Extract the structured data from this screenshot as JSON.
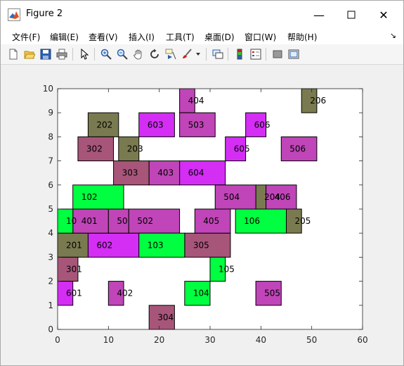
{
  "window": {
    "title": "Figure 2"
  },
  "menus": [
    "文件(F)",
    "编辑(E)",
    "查看(V)",
    "插入(I)",
    "工具(T)",
    "桌面(D)",
    "窗口(W)",
    "帮助(H)"
  ],
  "toolbar": [
    "new-figure-icon",
    "open-file-icon",
    "save-icon",
    "print-icon",
    "pointer-icon",
    "zoom-in-icon",
    "zoom-out-icon",
    "pan-icon",
    "rotate-3d-icon",
    "data-cursor-icon",
    "brush-icon",
    "brush-dropdown-icon",
    "link-plot-icon",
    "colorbar-icon",
    "legend-icon",
    "hide-plot-tools-icon",
    "show-plot-tools-icon"
  ],
  "colors": {
    "olive": "#7a7a50",
    "mauve": "#a8557a",
    "magenta": "#d42ef5",
    "orchid": "#c045b8",
    "green": "#00ff40"
  },
  "chart_data": {
    "type": "rectangles",
    "xlim": [
      0,
      60
    ],
    "ylim": [
      0,
      10
    ],
    "xticks": [
      0,
      10,
      20,
      30,
      40,
      50,
      60
    ],
    "yticks": [
      0,
      1,
      2,
      3,
      4,
      5,
      6,
      7,
      8,
      9,
      10
    ],
    "grid": false,
    "rects": [
      {
        "label": "201",
        "x0": 0,
        "x1": 6,
        "y0": 3,
        "y1": 4,
        "color": "olive"
      },
      {
        "label": "202",
        "x0": 6,
        "x1": 12,
        "y0": 8,
        "y1": 9,
        "color": "olive"
      },
      {
        "label": "203",
        "x0": 12,
        "x1": 16,
        "y0": 7,
        "y1": 8,
        "color": "olive"
      },
      {
        "label": "204",
        "x0": 39,
        "x1": 41,
        "y0": 5,
        "y1": 6,
        "color": "olive"
      },
      {
        "label": "205",
        "x0": 45,
        "x1": 48,
        "y0": 4,
        "y1": 5,
        "color": "olive"
      },
      {
        "label": "206",
        "x0": 48,
        "x1": 51,
        "y0": 9,
        "y1": 10,
        "color": "olive"
      },
      {
        "label": "301",
        "x0": 0,
        "x1": 4,
        "y0": 2,
        "y1": 3,
        "color": "mauve"
      },
      {
        "label": "302",
        "x0": 4,
        "x1": 11,
        "y0": 7,
        "y1": 8,
        "color": "mauve"
      },
      {
        "label": "303",
        "x0": 11,
        "x1": 18,
        "y0": 6,
        "y1": 7,
        "color": "mauve"
      },
      {
        "label": "304",
        "x0": 18,
        "x1": 23,
        "y0": 0,
        "y1": 1,
        "color": "mauve"
      },
      {
        "label": "305",
        "x0": 25,
        "x1": 34,
        "y0": 3,
        "y1": 4,
        "color": "mauve"
      },
      {
        "label": "601",
        "x0": 0,
        "x1": 3,
        "y0": 1,
        "y1": 2,
        "color": "magenta"
      },
      {
        "label": "602",
        "x0": 6,
        "x1": 16,
        "y0": 3,
        "y1": 4,
        "color": "magenta"
      },
      {
        "label": "603",
        "x0": 16,
        "x1": 23,
        "y0": 8,
        "y1": 9,
        "color": "magenta"
      },
      {
        "label": "604",
        "x0": 24,
        "x1": 33,
        "y0": 6,
        "y1": 7,
        "color": "magenta"
      },
      {
        "label": "605",
        "x0": 33,
        "x1": 37,
        "y0": 7,
        "y1": 8,
        "color": "magenta"
      },
      {
        "label": "606",
        "x0": 37,
        "x1": 41,
        "y0": 8,
        "y1": 9,
        "color": "magenta"
      },
      {
        "label": "401",
        "x0": 3,
        "x1": 10,
        "y0": 4,
        "y1": 5,
        "color": "orchid"
      },
      {
        "label": "50",
        "x0": 10,
        "x1": 14,
        "y0": 4,
        "y1": 5,
        "color": "orchid"
      },
      {
        "label": "502",
        "x0": 14,
        "x1": 24,
        "y0": 4,
        "y1": 5,
        "color": "orchid"
      },
      {
        "label": "402",
        "x0": 10,
        "x1": 13,
        "y0": 1,
        "y1": 2,
        "color": "orchid"
      },
      {
        "label": "403",
        "x0": 18,
        "x1": 24,
        "y0": 6,
        "y1": 7,
        "color": "orchid"
      },
      {
        "label": "404",
        "x0": 24,
        "x1": 27,
        "y0": 9,
        "y1": 10,
        "color": "orchid"
      },
      {
        "label": "503",
        "x0": 24,
        "x1": 31,
        "y0": 8,
        "y1": 9,
        "color": "orchid"
      },
      {
        "label": "504",
        "x0": 31,
        "x1": 39,
        "y0": 5,
        "y1": 6,
        "color": "orchid"
      },
      {
        "label": "405",
        "x0": 27,
        "x1": 34,
        "y0": 4,
        "y1": 5,
        "color": "orchid"
      },
      {
        "label": "406",
        "x0": 41,
        "x1": 47,
        "y0": 5,
        "y1": 6,
        "color": "orchid"
      },
      {
        "label": "505",
        "x0": 39,
        "x1": 44,
        "y0": 1,
        "y1": 2,
        "color": "orchid"
      },
      {
        "label": "506",
        "x0": 44,
        "x1": 51,
        "y0": 7,
        "y1": 8,
        "color": "orchid"
      },
      {
        "label": "10",
        "x0": 0,
        "x1": 3,
        "y0": 4,
        "y1": 5,
        "color": "green"
      },
      {
        "label": "102",
        "x0": 3,
        "x1": 13,
        "y0": 5,
        "y1": 6,
        "color": "green"
      },
      {
        "label": "103",
        "x0": 16,
        "x1": 25,
        "y0": 3,
        "y1": 4,
        "color": "green"
      },
      {
        "label": "104",
        "x0": 25,
        "x1": 30,
        "y0": 1,
        "y1": 2,
        "color": "green"
      },
      {
        "label": "105",
        "x0": 30,
        "x1": 33,
        "y0": 2,
        "y1": 3,
        "color": "green"
      },
      {
        "label": "106",
        "x0": 35,
        "x1": 45,
        "y0": 4,
        "y1": 5,
        "color": "green"
      }
    ]
  }
}
